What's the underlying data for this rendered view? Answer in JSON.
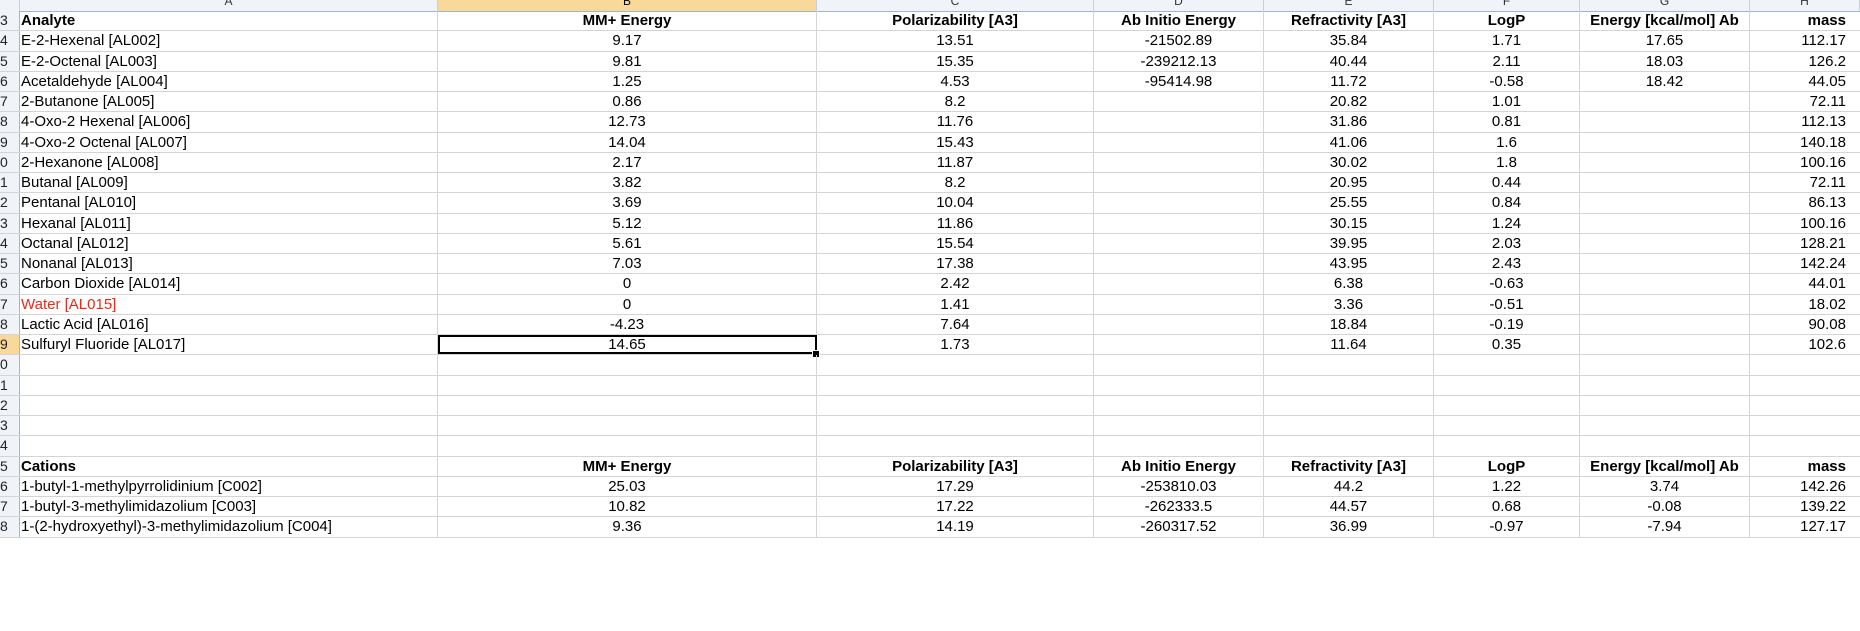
{
  "columns": [
    "A",
    "B",
    "C",
    "D",
    "E",
    "F",
    "G",
    "H"
  ],
  "selected_column": "B",
  "selected_row": "9",
  "rows": [
    {
      "n": "3",
      "bold": true,
      "cells": [
        "Analyte",
        "MM+ Energy",
        "Polarizability [A3]",
        "Ab Initio Energy",
        "Refractivity [A3]",
        "LogP",
        "Energy [kcal/mol] Ab",
        "mass"
      ]
    },
    {
      "n": "4",
      "cells": [
        "E-2-Hexenal [AL002]",
        "9.17",
        "13.51",
        "-21502.89",
        "35.84",
        "1.71",
        "17.65",
        "112.17"
      ]
    },
    {
      "n": "5",
      "cells": [
        "E-2-Octenal [AL003]",
        "9.81",
        "15.35",
        "-239212.13",
        "40.44",
        "2.11",
        "18.03",
        "126.2"
      ]
    },
    {
      "n": "6",
      "cells": [
        "Acetaldehyde [AL004]",
        "1.25",
        "4.53",
        "-95414.98",
        "11.72",
        "-0.58",
        "18.42",
        "44.05"
      ]
    },
    {
      "n": "7",
      "cells": [
        "2-Butanone [AL005]",
        "0.86",
        "8.2",
        "",
        "20.82",
        "1.01",
        "",
        "72.11"
      ]
    },
    {
      "n": "8",
      "cells": [
        "4-Oxo-2 Hexenal [AL006]",
        "12.73",
        "11.76",
        "",
        "31.86",
        "0.81",
        "",
        "112.13"
      ]
    },
    {
      "n": "9",
      "cells": [
        "4-Oxo-2 Octenal [AL007]",
        "14.04",
        "15.43",
        "",
        "41.06",
        "1.6",
        "",
        "140.18"
      ]
    },
    {
      "n": "0",
      "cells": [
        "2-Hexanone [AL008]",
        "2.17",
        "11.87",
        "",
        "30.02",
        "1.8",
        "",
        "100.16"
      ]
    },
    {
      "n": "1",
      "cells": [
        "Butanal [AL009]",
        "3.82",
        "8.2",
        "",
        "20.95",
        "0.44",
        "",
        "72.11"
      ]
    },
    {
      "n": "2",
      "cells": [
        "Pentanal [AL010]",
        "3.69",
        "10.04",
        "",
        "25.55",
        "0.84",
        "",
        "86.13"
      ]
    },
    {
      "n": "3",
      "cells": [
        "Hexanal [AL011]",
        "5.12",
        "11.86",
        "",
        "30.15",
        "1.24",
        "",
        "100.16"
      ]
    },
    {
      "n": "4",
      "cells": [
        "Octanal [AL012]",
        "5.61",
        "15.54",
        "",
        "39.95",
        "2.03",
        "",
        "128.21"
      ]
    },
    {
      "n": "5",
      "cells": [
        "Nonanal [AL013]",
        "7.03",
        "17.38",
        "",
        "43.95",
        "2.43",
        "",
        "142.24"
      ]
    },
    {
      "n": "6",
      "cells": [
        "Carbon Dioxide [AL014]",
        "0",
        "2.42",
        "",
        "6.38",
        "-0.63",
        "",
        "44.01"
      ]
    },
    {
      "n": "7",
      "red": true,
      "cells": [
        "Water [AL015]",
        "0",
        "1.41",
        "",
        "3.36",
        "-0.51",
        "",
        "18.02"
      ]
    },
    {
      "n": "8",
      "cells": [
        "Lactic Acid [AL016]",
        "-4.23",
        "7.64",
        "",
        "18.84",
        "-0.19",
        "",
        "90.08"
      ]
    },
    {
      "n": "9",
      "active": true,
      "cells": [
        "Sulfuryl Fluoride [AL017]",
        "14.65",
        "1.73",
        "",
        "11.64",
        "0.35",
        "",
        "102.6"
      ]
    },
    {
      "n": "0",
      "cells": [
        "",
        "",
        "",
        "",
        "",
        "",
        "",
        ""
      ]
    },
    {
      "n": "1",
      "cells": [
        "",
        "",
        "",
        "",
        "",
        "",
        "",
        ""
      ]
    },
    {
      "n": "2",
      "cells": [
        "",
        "",
        "",
        "",
        "",
        "",
        "",
        ""
      ]
    },
    {
      "n": "3",
      "cells": [
        "",
        "",
        "",
        "",
        "",
        "",
        "",
        ""
      ]
    },
    {
      "n": "4",
      "cells": [
        "",
        "",
        "",
        "",
        "",
        "",
        "",
        ""
      ]
    },
    {
      "n": "5",
      "bold": true,
      "cells": [
        "Cations",
        "MM+ Energy",
        "Polarizability [A3]",
        "Ab Initio Energy",
        "Refractivity [A3]",
        "LogP",
        "Energy [kcal/mol] Ab",
        "mass"
      ]
    },
    {
      "n": "6",
      "cells": [
        "1-butyl-1-methylpyrrolidinium [C002]",
        "25.03",
        "17.29",
        "-253810.03",
        "44.2",
        "1.22",
        "3.74",
        "142.26"
      ]
    },
    {
      "n": "7",
      "cells": [
        "1-butyl-3-methylimidazolium [C003]",
        "10.82",
        "17.22",
        "-262333.5",
        "44.57",
        "0.68",
        "-0.08",
        "139.22"
      ]
    },
    {
      "n": "8",
      "cells": [
        "1-(2-hydroxyethyl)-3-methylimidazolium [C004]",
        "9.36",
        "14.19",
        "-260317.52",
        "36.99",
        "-0.97",
        "-7.94",
        "127.17"
      ]
    }
  ]
}
